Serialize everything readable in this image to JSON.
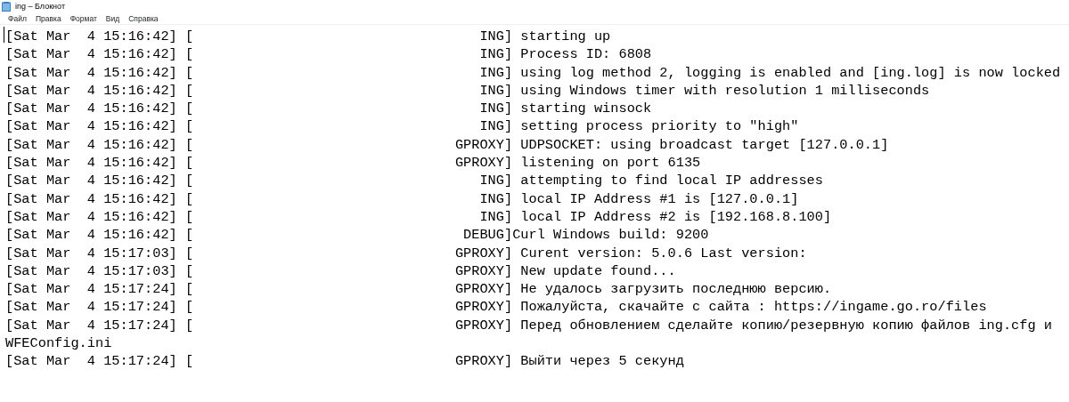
{
  "window": {
    "title": "ing – Блокнот"
  },
  "menu": [
    "Файл",
    "Правка",
    "Формат",
    "Вид",
    "Справка"
  ],
  "lines": [
    "[Sat Mar  4 15:16:42] [                                   ING] starting up",
    "[Sat Mar  4 15:16:42] [                                   ING] Process ID: 6808",
    "[Sat Mar  4 15:16:42] [                                   ING] using log method 2, logging is enabled and [ing.log] is now locked",
    "[Sat Mar  4 15:16:42] [                                   ING] using Windows timer with resolution 1 milliseconds",
    "[Sat Mar  4 15:16:42] [                                   ING] starting winsock",
    "[Sat Mar  4 15:16:42] [                                   ING] setting process priority to \"high\"",
    "[Sat Mar  4 15:16:42] [                                GPROXY] UDPSOCKET: using broadcast target [127.0.0.1]",
    "[Sat Mar  4 15:16:42] [                                GPROXY] listening on port 6135",
    "[Sat Mar  4 15:16:42] [                                   ING] attempting to find local IP addresses",
    "[Sat Mar  4 15:16:42] [                                   ING] local IP Address #1 is [127.0.0.1]",
    "[Sat Mar  4 15:16:42] [                                   ING] local IP Address #2 is [192.168.8.100]",
    "[Sat Mar  4 15:16:42] [                                 DEBUG]Curl Windows build: 9200",
    "[Sat Mar  4 15:17:03] [                                GPROXY] Curent version: 5.0.6 Last version:",
    "[Sat Mar  4 15:17:03] [                                GPROXY] New update found...",
    "[Sat Mar  4 15:17:24] [                                GPROXY] Не удалось загрузить последнюю версию.",
    "[Sat Mar  4 15:17:24] [                                GPROXY] Пожалуйста, скачайте с сайта : https://ingame.go.ro/files",
    "[Sat Mar  4 15:17:24] [                                GPROXY] Перед обновлением сделайте копию/резервную копию файлов ing.cfg и WFEConfig.ini",
    "[Sat Mar  4 15:17:24] [                                GPROXY] Выйти через 5 секунд"
  ]
}
